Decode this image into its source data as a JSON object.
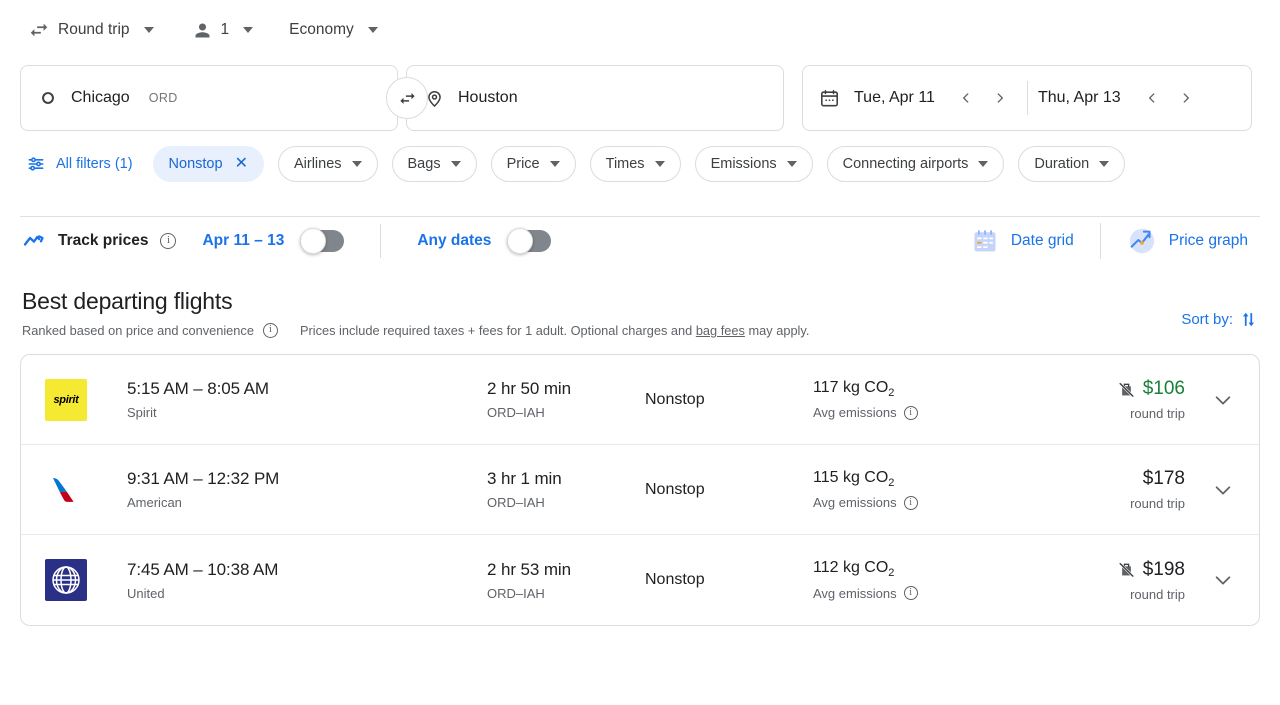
{
  "trip_options": {
    "trip_type": {
      "label": "Round trip",
      "icon": "swap-horizontal-icon"
    },
    "passengers": {
      "label": "1",
      "icon": "person-icon"
    },
    "cabin_class": {
      "label": "Economy"
    }
  },
  "search": {
    "origin": {
      "city": "Chicago",
      "code": "ORD",
      "icon": "circle-origin-icon"
    },
    "destination": {
      "city": "Houston",
      "code": "",
      "icon": "location-pin-icon"
    },
    "swap_icon": "swap-arrows-icon",
    "calendar_icon": "calendar-icon",
    "depart_date": "Tue, Apr 11",
    "return_date": "Thu, Apr 13",
    "prev_icon": "chevron-left-icon",
    "next_icon": "chevron-right-icon"
  },
  "filters": {
    "all_filters_label": "All filters (1)",
    "all_filters_icon": "tune-icon",
    "chips": [
      {
        "label": "Nonstop",
        "active": true,
        "close_icon": "close-icon"
      },
      {
        "label": "Airlines",
        "active": false
      },
      {
        "label": "Bags",
        "active": false
      },
      {
        "label": "Price",
        "active": false
      },
      {
        "label": "Times",
        "active": false
      },
      {
        "label": "Emissions",
        "active": false
      },
      {
        "label": "Connecting airports",
        "active": false
      },
      {
        "label": "Duration",
        "active": false
      }
    ]
  },
  "track_prices": {
    "icon": "trending-up-icon",
    "label": "Track prices",
    "info_icon": "info-icon",
    "date_range_label": "Apr 11 – 13",
    "date_range_toggle_on": false,
    "any_dates_label": "Any dates",
    "any_dates_toggle_on": false,
    "date_grid_label": "Date grid",
    "date_grid_icon": "calendar-grid-icon",
    "price_graph_label": "Price graph",
    "price_graph_icon": "price-graph-icon"
  },
  "section": {
    "title": "Best departing flights",
    "ranked_note": "Ranked based on price and convenience",
    "info_icon": "info-icon",
    "fees_note_before": "Prices include required taxes + fees for 1 adult. Optional charges and ",
    "fees_link": "bag fees",
    "fees_note_after": " may apply.",
    "sort_by_label": "Sort by:",
    "sort_icon": "sort-arrows-icon"
  },
  "colors": {
    "accent_blue": "#1a73e8",
    "chip_active_bg": "#e8f0fe",
    "chip_active_text": "#1967d2",
    "price_green": "#188038",
    "spirit_yellow": "#f5e932",
    "united_blue": "#2b3087",
    "american_blue": "#0078d2",
    "american_red": "#c30019"
  },
  "flights": [
    {
      "airline": "Spirit",
      "logo": "spirit-logo",
      "logo_text": "spirit",
      "times": "5:15 AM – 8:05 AM",
      "duration": "2 hr 50 min",
      "route": "ORD–IAH",
      "stops": "Nonstop",
      "emissions": "117 kg CO",
      "emissions_sub_digit": "2",
      "emissions_label": "Avg emissions",
      "emissions_info_icon": "info-icon",
      "no_bag_icon": "no-carry-on-bag-icon",
      "has_no_bag_icon": true,
      "price": "$106",
      "price_is_green": true,
      "price_sub": "round trip",
      "expand_icon": "chevron-down-icon"
    },
    {
      "airline": "American",
      "logo": "american-airlines-logo",
      "logo_text": "",
      "times": "9:31 AM – 12:32 PM",
      "duration": "3 hr 1 min",
      "route": "ORD–IAH",
      "stops": "Nonstop",
      "emissions": "115 kg CO",
      "emissions_sub_digit": "2",
      "emissions_label": "Avg emissions",
      "emissions_info_icon": "info-icon",
      "no_bag_icon": "",
      "has_no_bag_icon": false,
      "price": "$178",
      "price_is_green": false,
      "price_sub": "round trip",
      "expand_icon": "chevron-down-icon"
    },
    {
      "airline": "United",
      "logo": "united-airlines-logo",
      "logo_text": "",
      "times": "7:45 AM – 10:38 AM",
      "duration": "2 hr 53 min",
      "route": "ORD–IAH",
      "stops": "Nonstop",
      "emissions": "112 kg CO",
      "emissions_sub_digit": "2",
      "emissions_label": "Avg emissions",
      "emissions_info_icon": "info-icon",
      "no_bag_icon": "no-carry-on-bag-icon",
      "has_no_bag_icon": true,
      "price": "$198",
      "price_is_green": false,
      "price_sub": "round trip",
      "expand_icon": "chevron-down-icon"
    }
  ]
}
